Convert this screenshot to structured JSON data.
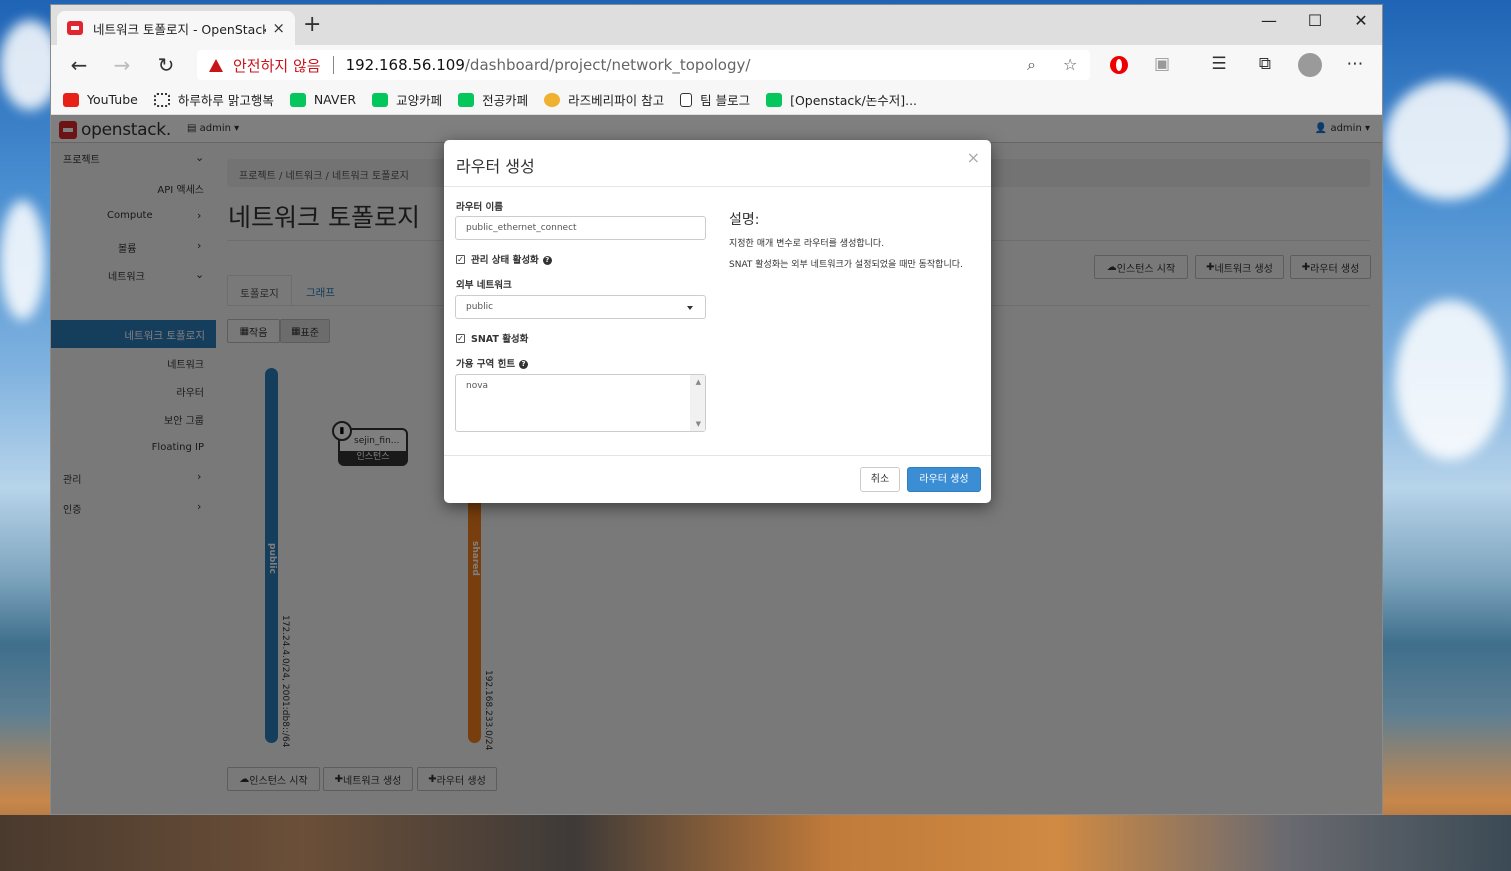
{
  "browser": {
    "tab_title": "네트워크 토폴로지 - OpenStack D",
    "tab_close": "×",
    "new_tab": "+",
    "minimize": "—",
    "maximize": "☐",
    "close": "✕",
    "security_warning": "안전하지 않음",
    "url_host": "192.168.56.109",
    "url_path": "/dashboard/project/network_topology/"
  },
  "bookmarks": [
    {
      "label": "YouTube",
      "icon": "youtube-icon",
      "color": "#e62117"
    },
    {
      "label": "하루하루 맑고행복",
      "icon": "dots-icon",
      "color": "#333333"
    },
    {
      "label": "NAVER",
      "icon": "naver-icon",
      "color": "#03c75a"
    },
    {
      "label": "교양카페",
      "icon": "cafe-icon",
      "color": "#03c75a"
    },
    {
      "label": "전공카페",
      "icon": "cafe-icon",
      "color": "#03c75a"
    },
    {
      "label": "라즈베리파이 참고",
      "icon": "emoji-icon",
      "color": "#f0b030"
    },
    {
      "label": "팀 블로그",
      "icon": "page-icon",
      "color": "#ffffff"
    },
    {
      "label": "[Openstack/논수저]...",
      "icon": "blog-icon",
      "color": "#03c75a"
    }
  ],
  "openstack": {
    "logo": "openstack.",
    "project": "admin",
    "user": "admin"
  },
  "sidebar": {
    "project": "프로젝트",
    "api_access": "API 액세스",
    "compute": "Compute",
    "volume": "볼륨",
    "network": "네트워크",
    "network_topology": "네트워크 토폴로지",
    "networks": "네트워크",
    "routers": "라우터",
    "security_groups": "보안 그룹",
    "floating_ip": "Floating IP",
    "admin": "관리",
    "identity": "인증"
  },
  "content": {
    "breadcrumb": "프로젝트 / 네트워크 / 네트워크 토폴로지",
    "title": "네트워크 토폴로지",
    "launch_instance": "인스턴스 시작",
    "create_network": "네트워크 생성",
    "create_router": "라우터 생성",
    "tab_topology": "토폴로지",
    "tab_graph": "그래프",
    "view_small": "작음",
    "view_normal": "표준",
    "networks": [
      {
        "name": "public",
        "cidr": "172.24.4.0/24, 2001:db8::/64",
        "color": "#2a7ab8"
      },
      {
        "name": "shared",
        "cidr": "192.168.233.0/24",
        "color": "#f07d1a"
      }
    ],
    "instance_name": "sejin_fin...",
    "instance_label": "인스턴스"
  },
  "modal": {
    "title": "라우터 생성",
    "close": "×",
    "router_name_label": "라우터 이름",
    "router_name_value": "public_ethernet_connect",
    "admin_state_label": "관리 상태 활성화",
    "admin_state_checked": true,
    "external_network_label": "외부 네트워크",
    "external_network_value": "public",
    "snat_label": "SNAT 활성화",
    "snat_checked": true,
    "az_hint_label": "가용 구역 힌트",
    "az_hint_value": "nova",
    "description_title": "설명:",
    "description_1": "지정한 매개 변수로 라우터를 생성합니다.",
    "description_2": "SNAT 활성화는 외부 네트워크가 설정되었을 때만 동작합니다.",
    "cancel": "취소",
    "submit": "라우터 생성",
    "primary_color": "#3b8ed4"
  }
}
